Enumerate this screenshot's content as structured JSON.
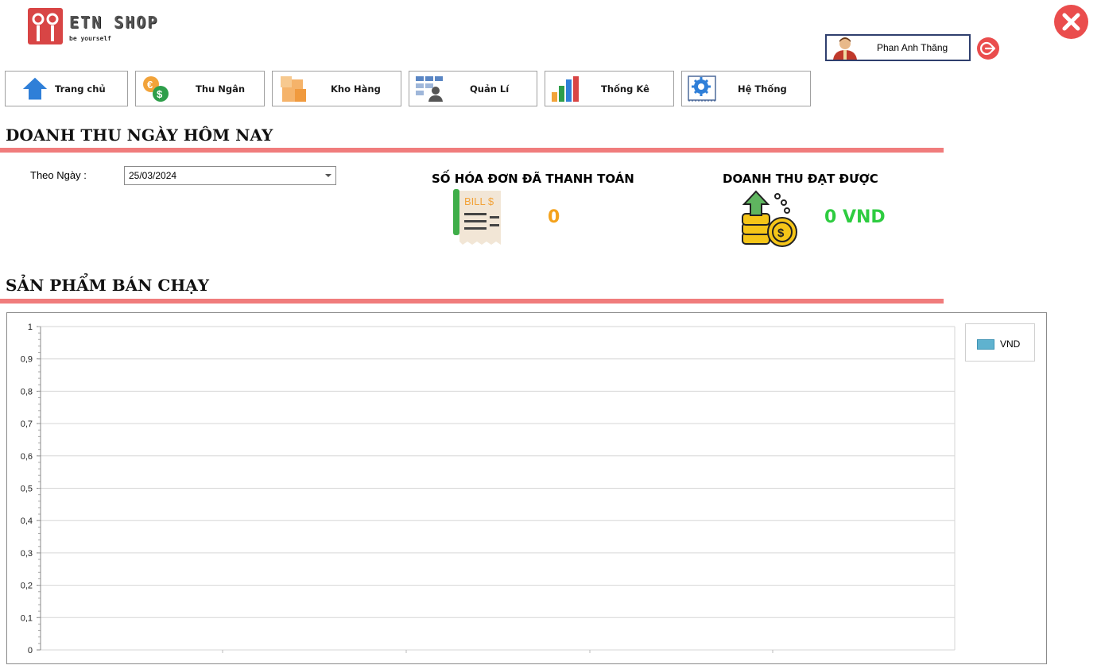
{
  "app": {
    "logo_text": "ETN SHOP",
    "logo_subtitle": "be yourself"
  },
  "user": {
    "name": "Phan Anh Thăng"
  },
  "nav": [
    {
      "label": "Trang chủ",
      "icon": "home-icon"
    },
    {
      "label": "Thu Ngân",
      "icon": "cashier-icon"
    },
    {
      "label": "Kho Hàng",
      "icon": "warehouse-icon"
    },
    {
      "label": "Quản Lí",
      "icon": "manage-icon"
    },
    {
      "label": "Thống Kê",
      "icon": "statistics-icon"
    },
    {
      "label": "Hệ Thống",
      "icon": "system-icon"
    }
  ],
  "sections": {
    "today_revenue": "DOANH THU NGÀY HÔM NAY",
    "best_sellers": "SẢN PHẨM BÁN CHẠY"
  },
  "filter": {
    "label": "Theo Ngày :",
    "date": "25/03/2024"
  },
  "stats": {
    "invoices_title": "SỐ HÓA ĐƠN ĐÃ THANH TOÁN",
    "invoices_value": "0",
    "invoices_color": "#f4a21c",
    "revenue_title": "DOANH THU ĐẠT ĐƯỢC",
    "revenue_value": "0 VND",
    "revenue_color": "#2ecc40",
    "bill_icon_text": "BILL $"
  },
  "colors": {
    "accent_line": "#f07c7c",
    "close": "#ea4d4d",
    "series": "#5fb2cf"
  },
  "chart_data": {
    "type": "bar",
    "categories": [],
    "series": [
      {
        "name": "VND",
        "values": []
      }
    ],
    "ylim": [
      0,
      1
    ],
    "yticks": [
      "1",
      "0,9",
      "0,8",
      "0,7",
      "0,6",
      "0,5",
      "0,4",
      "0,3",
      "0,2",
      "0,1",
      "0"
    ],
    "grid": true,
    "legend": "top-right"
  }
}
